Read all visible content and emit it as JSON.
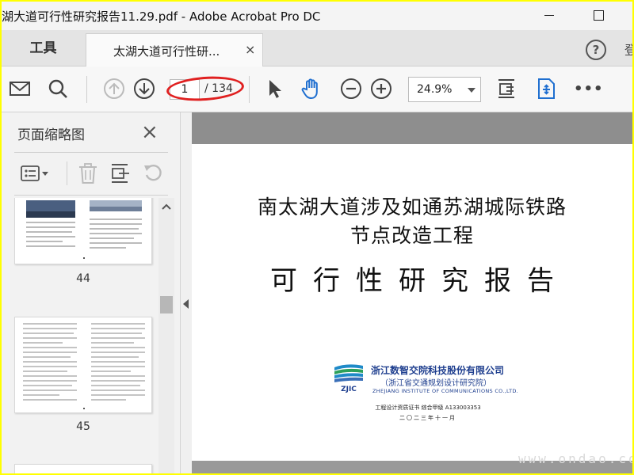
{
  "window": {
    "title": "湖大道可行性研究报告11.29.pdf - Adobe Acrobat Pro DC"
  },
  "tabs": {
    "tools_label": "工具",
    "document_label": "太湖大道可行性研...",
    "close_glyph": "×",
    "help_glyph": "?",
    "login_partial": "登"
  },
  "toolbar": {
    "current_page": "1",
    "total_pages": "/ 134",
    "zoom": "24.9%",
    "more_glyph": "•••"
  },
  "icons": [
    "mail-icon",
    "search-icon",
    "arrow-up-icon",
    "arrow-down-icon",
    "select-arrow-icon",
    "hand-icon",
    "zoom-out-icon",
    "zoom-in-icon",
    "fit-page-icon",
    "rotate-view-icon",
    "more-icon",
    "options-list-icon",
    "trash-icon",
    "insert-page-icon",
    "undo-icon"
  ],
  "colors": {
    "accent": "#1f6fd0",
    "annotation_red": "#e02020",
    "frame_yellow": "#ffff00"
  },
  "left_panel": {
    "title": "页面缩略图",
    "close_glyph": "×",
    "thumbnails": [
      {
        "page": "44"
      },
      {
        "page": "45"
      }
    ]
  },
  "document": {
    "line1": "南太湖大道涉及如通苏湖城际铁路",
    "line2": "节点改造工程",
    "line3": "可行性研究报告",
    "logo_text": "ZJIC",
    "company_cn": "浙江数智交院科技股份有限公司",
    "company_cn2": "（浙江省交通规划设计研究院）",
    "company_en": "ZHEJIANG INSTITUTE OF COMMUNICATIONS CO.,LTD.",
    "cert": "工程设计资质证书 综合甲级 A133003353",
    "date": "二〇二三年十一月"
  },
  "watermark": "www.ondao.com"
}
